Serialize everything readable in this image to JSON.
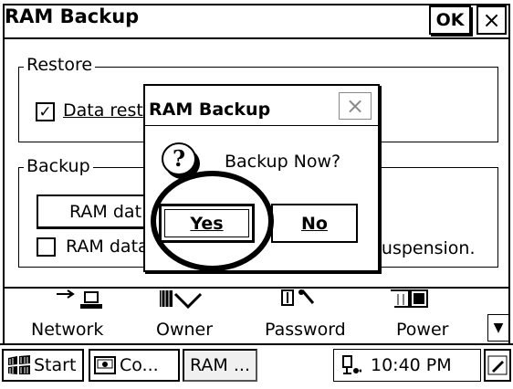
{
  "window": {
    "title": "RAM Backup",
    "ok_label": "OK",
    "close_label": "×"
  },
  "restore": {
    "legend": "Restore",
    "checkbox_label": "Data rest",
    "checked": true
  },
  "backup": {
    "legend": "Backup",
    "button_label": "RAM dat",
    "checkbox_label": "RAM data",
    "checked": false,
    "trailing_text": "suspension."
  },
  "dialog": {
    "title": "RAM Backup",
    "close_label": "×",
    "message": "Backup Now?",
    "yes_label": "Yes",
    "no_label": "No"
  },
  "control_panel": {
    "items": [
      {
        "label": "Network",
        "icon": "network-icon"
      },
      {
        "label": "Owner",
        "icon": "owner-icon"
      },
      {
        "label": "Password",
        "icon": "password-icon"
      },
      {
        "label": "Power",
        "icon": "power-icon"
      }
    ]
  },
  "taskbar": {
    "start_label": "Start",
    "co_label": "Co...",
    "ram_label": "RAM ...",
    "time": "10:40 PM"
  }
}
